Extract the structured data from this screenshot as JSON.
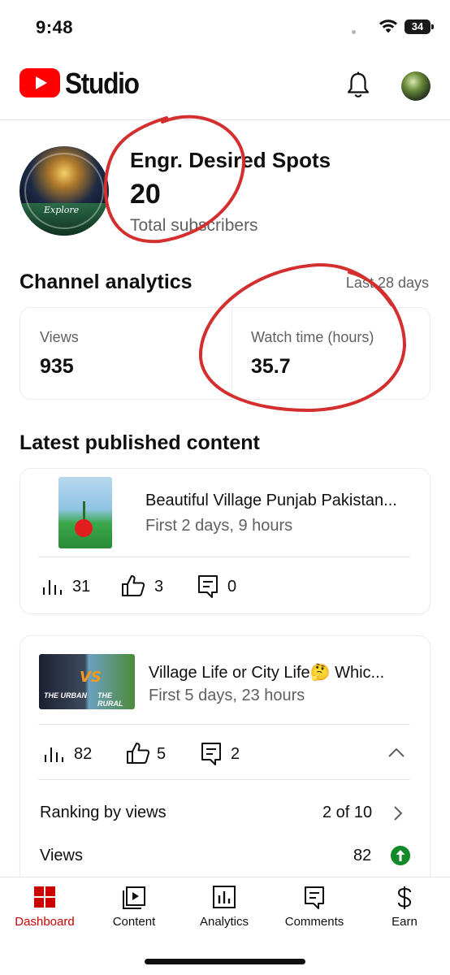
{
  "status_bar": {
    "time": "9:48",
    "battery": "34"
  },
  "header": {
    "app_name": "Studio",
    "logo_icon": "youtube-play-icon",
    "bell_icon": "bell-icon",
    "brand_color": "#ff0000"
  },
  "channel": {
    "name": "Engr. Desired Spots",
    "subscribers": "20",
    "subscribers_label": "Total subscribers",
    "avatar_caption": "Explore"
  },
  "analytics": {
    "title": "Channel analytics",
    "period": "Last 28 days",
    "metrics": [
      {
        "label": "Views",
        "value": "935"
      },
      {
        "label": "Watch time (hours)",
        "value": "35.7"
      }
    ]
  },
  "latest": {
    "title": "Latest published content",
    "videos": [
      {
        "title": "Beautiful Village Punjab Pakistan...",
        "subtitle": "First 2 days, 9 hours",
        "views": "31",
        "likes": "3",
        "comments": "0"
      },
      {
        "title": "Village Life or City Life🤔 Whic...",
        "subtitle": "First 5 days, 23 hours",
        "views": "82",
        "likes": "5",
        "comments": "2",
        "thumb_vs": "VS",
        "thumb_left": "THE URBAN",
        "thumb_right": "THE RURAL",
        "ranking_label": "Ranking by views",
        "ranking_value": "2 of 10",
        "views_label": "Views",
        "views_value": "82"
      }
    ]
  },
  "nav": {
    "items": [
      {
        "label": "Dashboard",
        "icon": "dashboard-icon",
        "active": true
      },
      {
        "label": "Content",
        "icon": "content-icon"
      },
      {
        "label": "Analytics",
        "icon": "analytics-icon"
      },
      {
        "label": "Comments",
        "icon": "comments-icon"
      },
      {
        "label": "Earn",
        "icon": "dollar-icon"
      }
    ]
  },
  "colors": {
    "active": "#cc0000",
    "secondary_text": "#606060",
    "marker": "#d32f2f",
    "success": "#138a2a"
  }
}
